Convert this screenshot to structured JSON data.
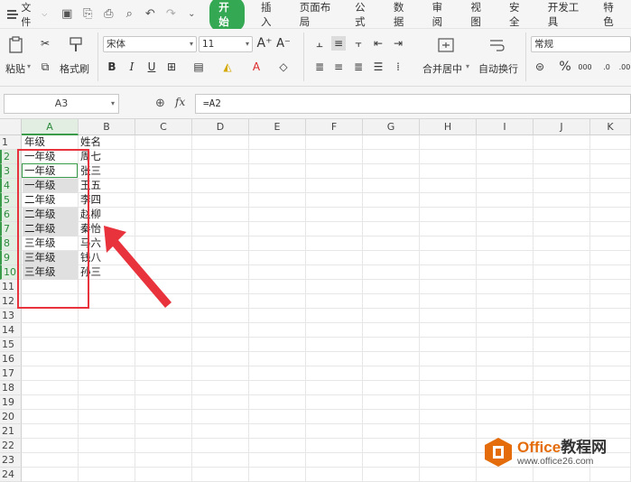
{
  "menu": {
    "file_label": "文件",
    "tabs": [
      "开始",
      "插入",
      "页面布局",
      "公式",
      "数据",
      "审阅",
      "视图",
      "安全",
      "开发工具",
      "特色"
    ],
    "active_tab": "开始"
  },
  "ribbon": {
    "paste_label": "粘贴",
    "format_painter_label": "格式刷",
    "font_name": "宋体",
    "font_size": "11",
    "merge_center_label": "合并居中",
    "wrap_text_label": "自动换行",
    "number_format": "常规"
  },
  "formula_bar": {
    "name_box": "A3",
    "fx_label": "fx",
    "formula": "=A2"
  },
  "sheet": {
    "columns": [
      "A",
      "B",
      "C",
      "D",
      "E",
      "F",
      "G",
      "H",
      "I",
      "J",
      "K"
    ],
    "selected_column": "A",
    "rows": [
      "1",
      "2",
      "3",
      "4",
      "5",
      "6",
      "7",
      "8",
      "9",
      "10",
      "11",
      "12",
      "13",
      "14",
      "15",
      "16",
      "17",
      "18",
      "19",
      "20",
      "21",
      "22",
      "23",
      "24"
    ],
    "data": [
      {
        "a": "年级",
        "b": "姓名"
      },
      {
        "a": "一年级",
        "b": "周七"
      },
      {
        "a": "一年级",
        "b": "张三"
      },
      {
        "a": "一年级",
        "b": "王五"
      },
      {
        "a": "二年级",
        "b": "李四"
      },
      {
        "a": "二年级",
        "b": "赵柳"
      },
      {
        "a": "二年级",
        "b": "秦怡"
      },
      {
        "a": "三年级",
        "b": "马六"
      },
      {
        "a": "三年级",
        "b": "钱八"
      },
      {
        "a": "三年级",
        "b": "孙三"
      }
    ]
  },
  "watermark": {
    "brand_office": "Office",
    "brand_cn": "教程网",
    "url": "www.office26.com"
  },
  "colors": {
    "accent_green": "#35a853",
    "annotation_red": "#e8323c",
    "watermark_orange": "#e46c0a"
  }
}
